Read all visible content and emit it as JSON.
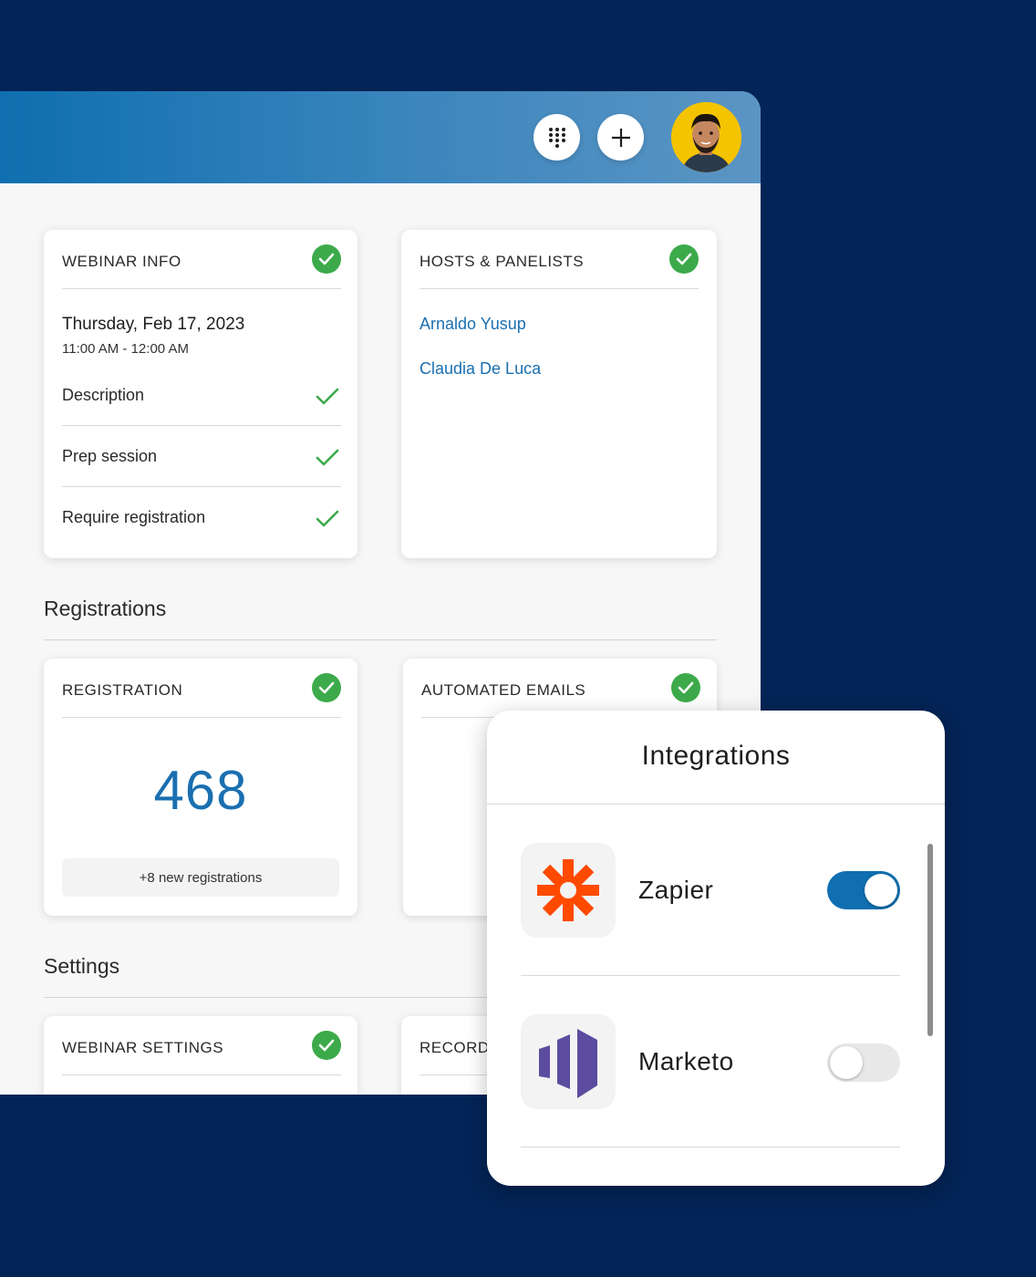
{
  "header": {
    "apps_icon": "dialpad-grid-icon",
    "add_icon": "plus-icon",
    "avatar_icon": "user-avatar"
  },
  "webinar_info": {
    "title": "WEBINAR INFO",
    "date": "Thursday, Feb 17, 2023",
    "time": "11:00 AM - 12:00 AM",
    "rows": [
      {
        "label": "Description"
      },
      {
        "label": "Prep session"
      },
      {
        "label": "Require registration"
      }
    ]
  },
  "hosts": {
    "title": "HOSTS & PANELISTS",
    "people": [
      "Arnaldo Yusup",
      "Claudia De Luca"
    ]
  },
  "registrations_section": {
    "title": "Registrations",
    "registration": {
      "title": "REGISTRATION",
      "count": "468",
      "new_text": "+8 new registrations"
    },
    "automated_emails": {
      "title": "AUTOMATED EMAILS"
    }
  },
  "settings_section": {
    "title": "Settings",
    "webinar_settings": {
      "title": "WEBINAR SETTINGS"
    },
    "recording": {
      "title": "RECORDI"
    }
  },
  "integrations": {
    "title": "Integrations",
    "items": [
      {
        "name": "Zapier",
        "enabled": true,
        "icon": "zapier-logo"
      },
      {
        "name": "Marketo",
        "enabled": false,
        "icon": "marketo-logo"
      }
    ]
  },
  "colors": {
    "page_bg": "#032456",
    "accent": "#1a6fb0",
    "check_green": "#3caa4a",
    "zapier_orange": "#ff4a00",
    "marketo_purple": "#5c4c9f"
  }
}
